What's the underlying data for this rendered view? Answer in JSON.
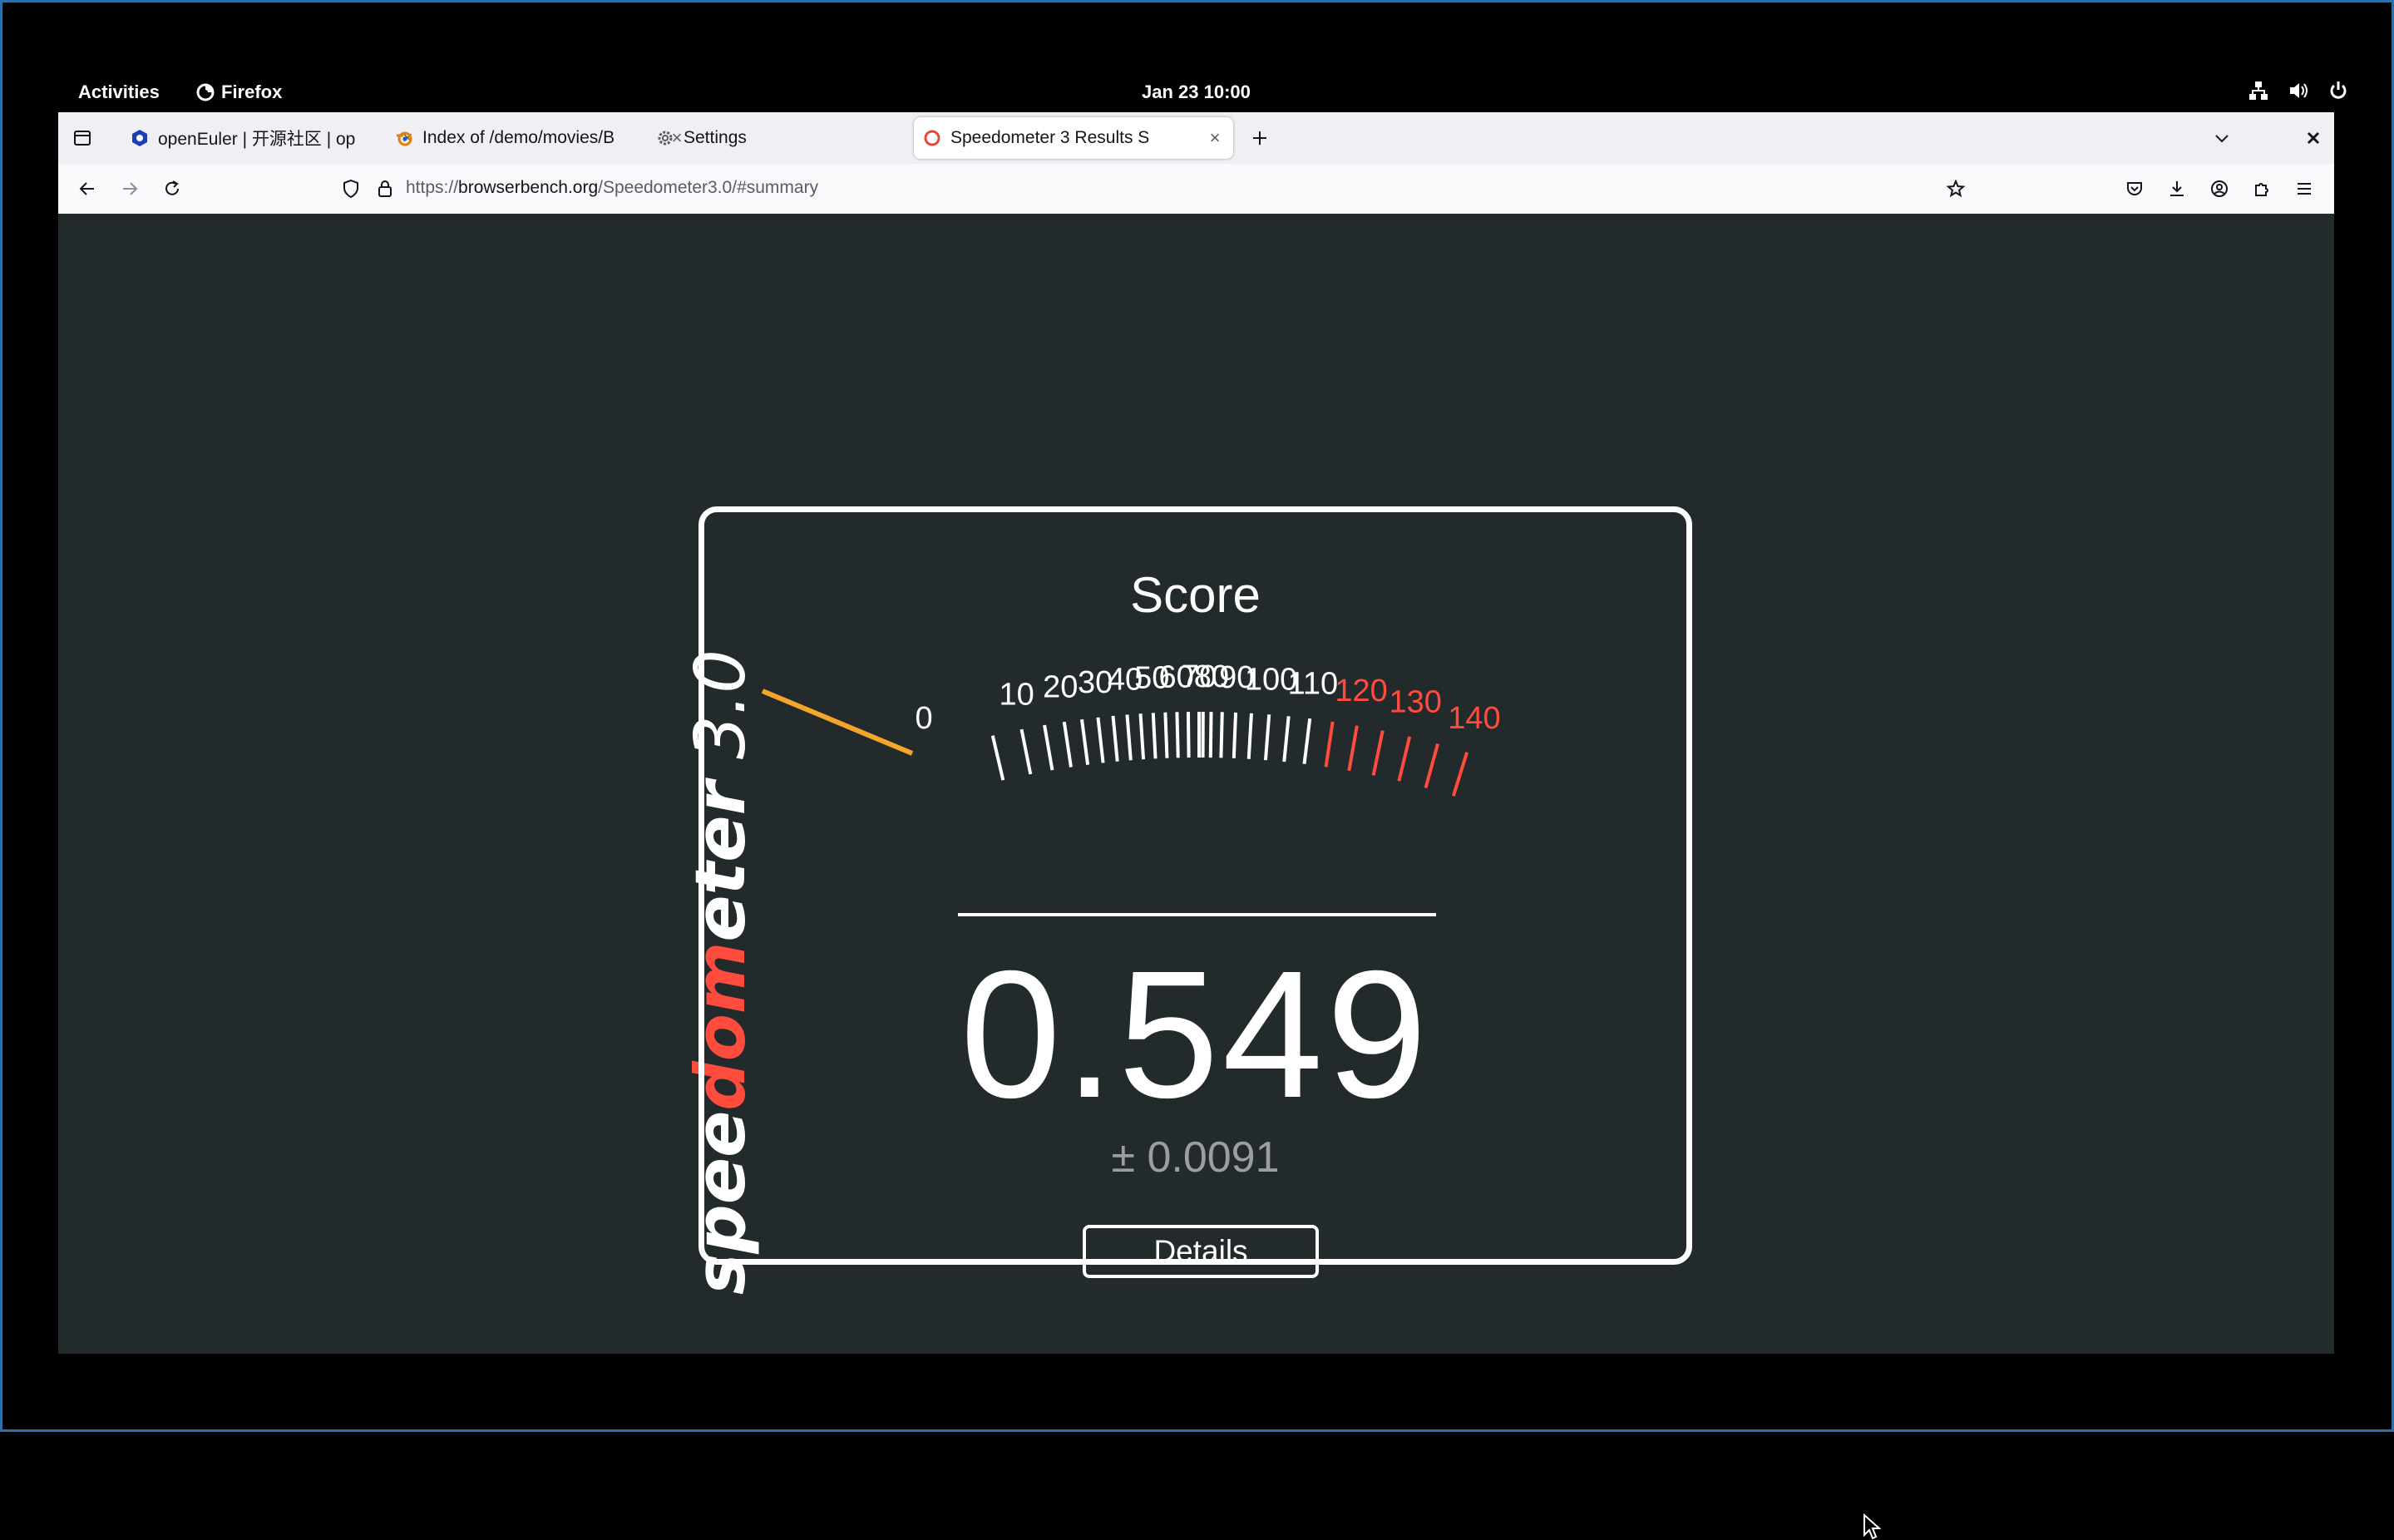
{
  "system": {
    "activities": "Activities",
    "app_name": "Firefox",
    "clock": "Jan 23  10:00"
  },
  "browser": {
    "tabs": [
      {
        "title": "openEuler | 开源社区 | op",
        "active": false
      },
      {
        "title": "Index of /demo/movies/B",
        "active": false
      },
      {
        "title": "Settings",
        "active": false
      },
      {
        "title": "Speedometer 3 Results S",
        "active": true
      }
    ],
    "url_prefix": "https://",
    "url_host": "browserbench.org",
    "url_path": "/Speedometer3.0/#summary"
  },
  "page": {
    "brand_part1": "spee",
    "brand_highlight": "dom",
    "brand_part2": "eter",
    "brand_version": " 3.0",
    "score_label": "Score",
    "score_value": "0.549",
    "score_error": "± 0.0091",
    "details_label": "Details"
  },
  "gauge": {
    "labels": [
      "0",
      "10",
      "20",
      "30",
      "40",
      "50",
      "60",
      "70",
      "80",
      "90",
      "100",
      "110",
      "120",
      "130",
      "140"
    ],
    "needle_value": 0.549,
    "colors": {
      "normal": "#ffffff",
      "high": "#ff4c3d",
      "needle": "#f6a52b"
    }
  }
}
